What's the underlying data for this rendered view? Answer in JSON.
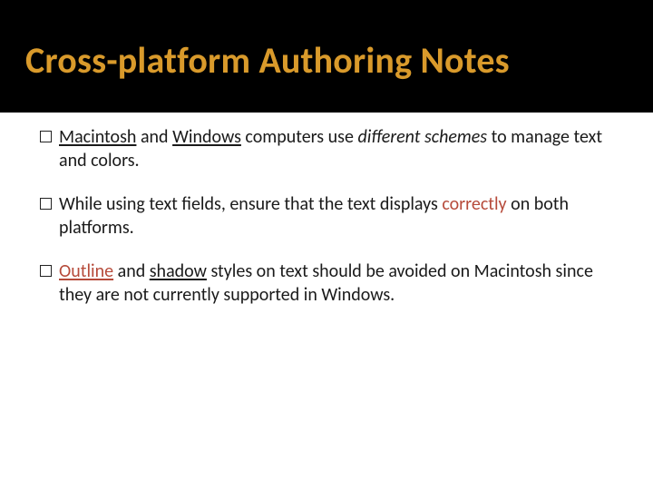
{
  "title": "Cross-platform Authoring Notes",
  "bullets": [
    {
      "parts": [
        {
          "t": "Macintosh",
          "ul": true
        },
        {
          "t": " and "
        },
        {
          "t": "Windows",
          "ul": true
        },
        {
          "t": " computers use "
        },
        {
          "t": "different schemes",
          "it": true
        },
        {
          "t": " to manage text and colors."
        }
      ]
    },
    {
      "parts": [
        {
          "t": "While using text fields, ensure that the text displays "
        },
        {
          "t": "correctly",
          "red": true
        },
        {
          "t": " on both platforms."
        }
      ]
    },
    {
      "parts": [
        {
          "t": "Outline",
          "ul": true,
          "red": true
        },
        {
          "t": " and "
        },
        {
          "t": "shadow",
          "ul": true
        },
        {
          "t": " styles on text should be avoided on Macintosh since they are not currently supported in Windows."
        }
      ]
    }
  ]
}
